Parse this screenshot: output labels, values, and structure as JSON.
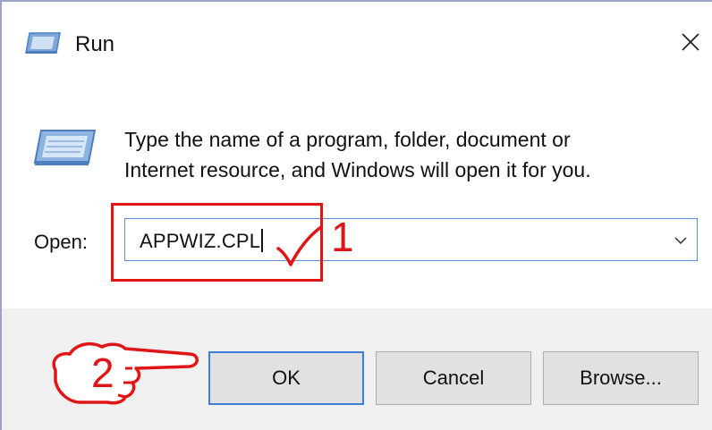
{
  "window": {
    "title": "Run",
    "close_icon": "close-icon"
  },
  "dialog": {
    "description_line1": "Type the name of a program, folder, document or",
    "description_line2": "Internet resource, and Windows will open it for you.",
    "open_label": "Open:",
    "open_value": "APPWIZ.CPL"
  },
  "buttons": {
    "ok": "OK",
    "cancel": "Cancel",
    "browse": "Browse..."
  },
  "annotations": {
    "step1": "1",
    "step2": "2",
    "color": "#e01616"
  },
  "colors": {
    "accent": "#3c7fd9",
    "footer_bg": "#f0f0f0",
    "button_bg": "#e1e1e1"
  }
}
